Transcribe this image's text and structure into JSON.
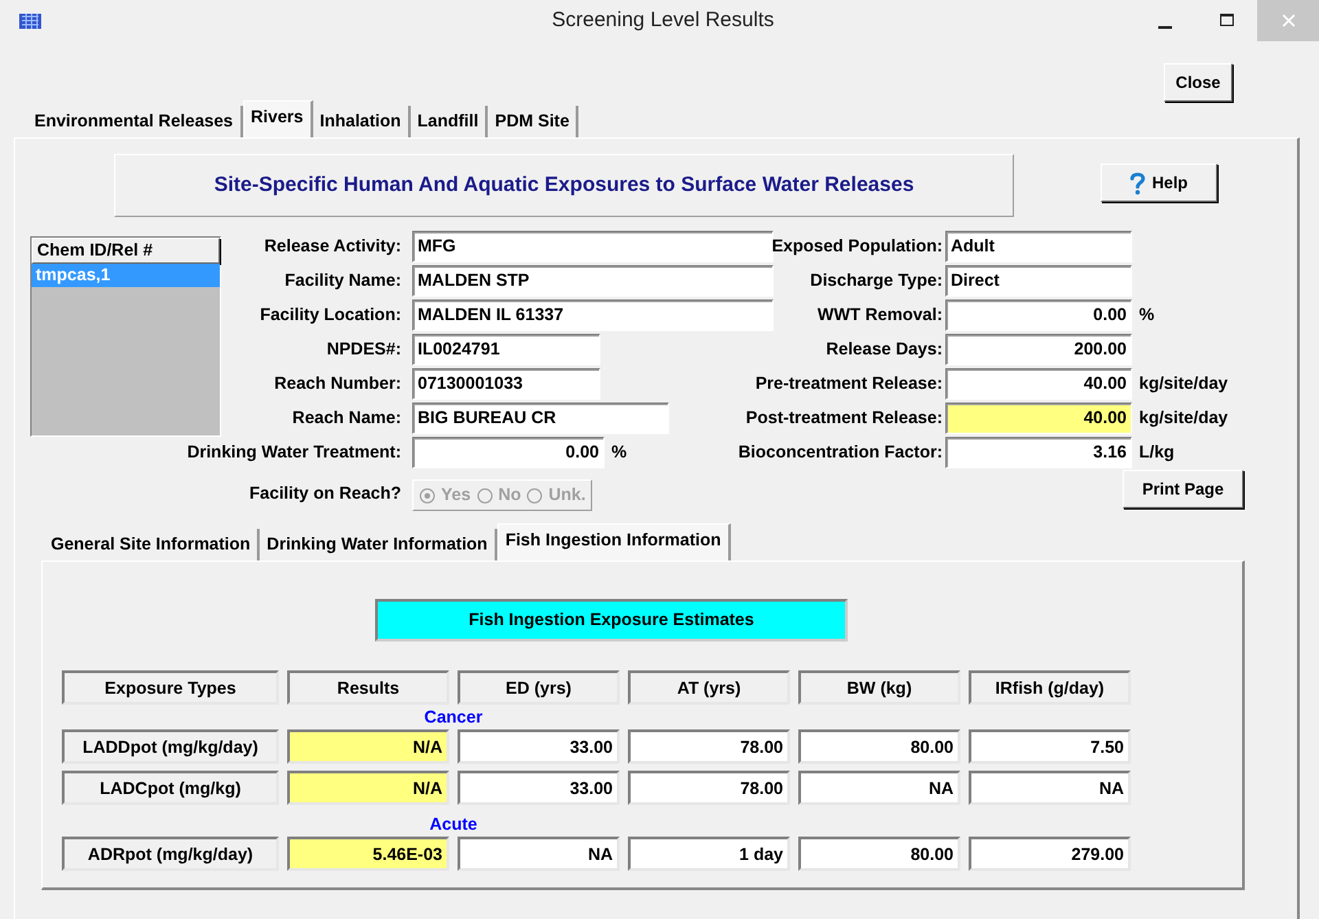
{
  "window": {
    "title": "Screening Level Results"
  },
  "close_button": "Close",
  "tabs": [
    {
      "label": "Environmental Releases",
      "selected": false
    },
    {
      "label": "Rivers",
      "selected": true
    },
    {
      "label": "Inhalation",
      "selected": false
    },
    {
      "label": "Landfill",
      "selected": false
    },
    {
      "label": "PDM Site",
      "selected": false
    }
  ],
  "panel": {
    "heading": "Site-Specific Human And Aquatic Exposures to Surface Water Releases",
    "help_button": "Help",
    "chem_list": {
      "header": "Chem ID/Rel #",
      "items": [
        {
          "label": "tmpcas,1",
          "selected": true
        }
      ]
    },
    "left_fields": [
      {
        "label": "Release Activity:",
        "value": "MFG",
        "kind": "text"
      },
      {
        "label": "Facility Name:",
        "value": "MALDEN STP",
        "kind": "text"
      },
      {
        "label": "Facility Location:",
        "value": "MALDEN IL 61337",
        "kind": "text"
      },
      {
        "label": "NPDES#:",
        "value": "IL0024791",
        "kind": "text"
      },
      {
        "label": "Reach Number:",
        "value": "07130001033",
        "kind": "text"
      },
      {
        "label": "Reach Name:",
        "value": "BIG BUREAU CR",
        "kind": "text"
      },
      {
        "label": "Drinking Water Treatment:",
        "value": "0.00",
        "kind": "number",
        "unit": "%"
      }
    ],
    "right_fields": [
      {
        "label": "Exposed Population:",
        "value": "Adult",
        "kind": "text",
        "highlighted": false
      },
      {
        "label": "Discharge Type:",
        "value": "Direct",
        "kind": "text",
        "highlighted": false
      },
      {
        "label": "WWT Removal:",
        "value": "0.00",
        "kind": "number",
        "unit": "%",
        "highlighted": false
      },
      {
        "label": "Release Days:",
        "value": "200.00",
        "kind": "number",
        "highlighted": false
      },
      {
        "label": "Pre-treatment Release:",
        "value": "40.00",
        "kind": "number",
        "unit": "kg/site/day",
        "highlighted": false
      },
      {
        "label": "Post-treatment Release:",
        "value": "40.00",
        "kind": "number",
        "unit": "kg/site/day",
        "highlighted": true
      },
      {
        "label": "Bioconcentration Factor:",
        "value": "3.16",
        "kind": "number",
        "unit": "L/kg",
        "highlighted": false
      }
    ],
    "facility_on_reach": {
      "label": "Facility on Reach?",
      "disabled": true,
      "options": [
        {
          "label": "Yes",
          "selected": true
        },
        {
          "label": "No",
          "selected": false
        },
        {
          "label": "Unk.",
          "selected": false
        }
      ]
    },
    "print_button": "Print Page",
    "subtabs": [
      {
        "label": "General Site Information",
        "selected": false
      },
      {
        "label": "Drinking Water Information",
        "selected": false
      },
      {
        "label": "Fish Ingestion Information",
        "selected": true
      }
    ],
    "fish": {
      "heading": "Fish Ingestion Exposure Estimates",
      "columns": [
        "Exposure Types",
        "Results",
        "ED (yrs)",
        "AT (yrs)",
        "BW (kg)",
        "IRfish (g/day)"
      ],
      "groups": [
        {
          "label": "Cancer",
          "rows": [
            {
              "type": "LADDpot (mg/kg/day)",
              "result": "N/A",
              "values": [
                "33.00",
                "78.00",
                "80.00",
                "7.50"
              ]
            },
            {
              "type": "LADCpot (mg/kg)",
              "result": "N/A",
              "values": [
                "33.00",
                "78.00",
                "NA",
                "NA"
              ]
            }
          ]
        },
        {
          "label": "Acute",
          "rows": [
            {
              "type": "ADRpot (mg/kg/day)",
              "result": "5.46E-03",
              "values": [
                "NA",
                "1 day",
                "80.00",
                "279.00"
              ]
            }
          ]
        }
      ]
    }
  }
}
